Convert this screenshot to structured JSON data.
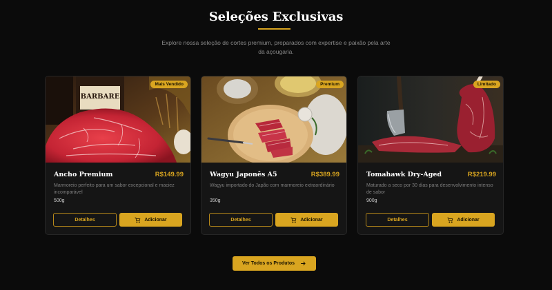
{
  "section": {
    "title": "Seleções Exclusivas",
    "subtitle": "Explore nossa seleção de cortes premium, preparados com expertise e paixão pela arte da açougaria."
  },
  "products": [
    {
      "badge": "Mais Vendido",
      "name": "Ancho Premium",
      "price": "R$149.99",
      "description": "Marmoreio perfeito para um sabor excepcional e maciez incomparável",
      "weight": "500g",
      "details_label": "Detalhes",
      "add_label": "Adicionar",
      "image_text": "BARBARE"
    },
    {
      "badge": "Premium",
      "name": "Wagyu Japonês A5",
      "price": "R$389.99",
      "description": "Wagyu importado do Japão com marmoreio extraordinário",
      "weight": "350g",
      "details_label": "Detalhes",
      "add_label": "Adicionar"
    },
    {
      "badge": "Limitado",
      "name": "Tomahawk Dry-Aged",
      "price": "R$219.99",
      "description": "Maturado a seco por 30 dias para desenvolvimento intenso de sabor",
      "weight": "900g",
      "details_label": "Detalhes",
      "add_label": "Adicionar"
    }
  ],
  "cta": {
    "label": "Ver Todos os Produtos"
  },
  "colors": {
    "accent": "#d9a520",
    "background": "#0b0b0b",
    "card": "#151515"
  },
  "icons": {
    "cart": "cart-icon",
    "arrow": "arrow-right-icon"
  }
}
